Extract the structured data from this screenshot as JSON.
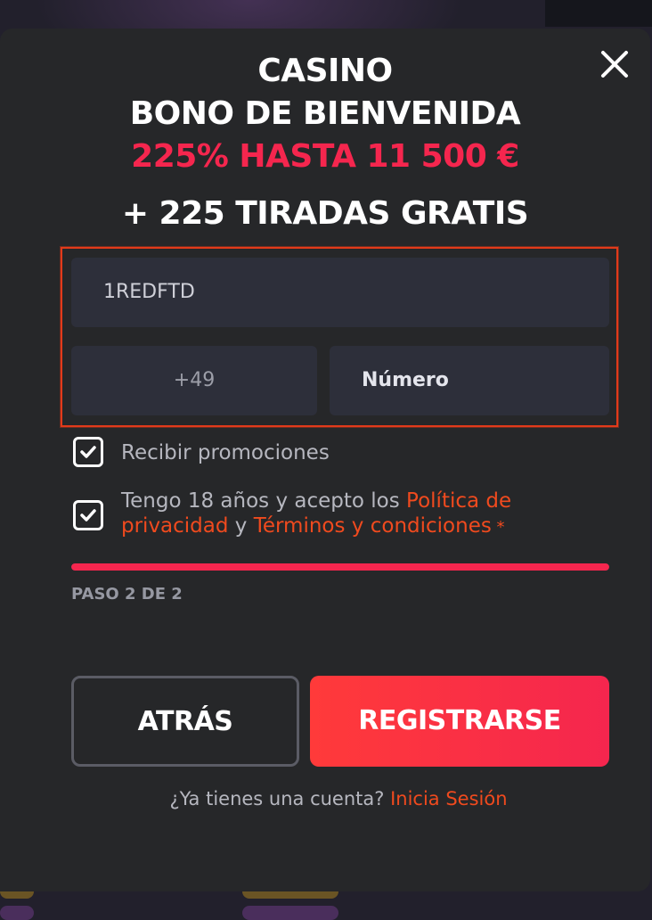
{
  "modal": {
    "title_line1": "CASINO",
    "title_line2": "BONO DE BIENVENIDA",
    "title_highlight": "225% HASTA 11 500 €",
    "title_line4": "+ 225 TIRADAS GRATIS"
  },
  "form": {
    "promo_code_value": "1REDFTD",
    "phone_prefix_value": "+49",
    "phone_number_placeholder": "Número"
  },
  "checkboxes": {
    "promotions_label": "Recibir promociones",
    "promotions_checked": true,
    "terms_prefix": "Tengo 18 años y acepto los ",
    "privacy_link": "Política de privacidad",
    "terms_joiner": " y ",
    "terms_link": "Términos y condiciones",
    "terms_required": " *",
    "terms_checked": true
  },
  "progress": {
    "step_label": "PASO 2 DE 2",
    "fraction": 1.0
  },
  "buttons": {
    "back_label": "ATRÁS",
    "register_label": "REGISTRARSE"
  },
  "login": {
    "prompt": "¿Ya tienes una cuenta? ",
    "link": "Inicia Sesión"
  },
  "colors": {
    "accent_red": "#f5264e",
    "link_orange": "#f04a1e",
    "modal_bg": "#262729",
    "field_bg": "#2d2f3a",
    "focus_border": "#e23a1a"
  },
  "icons": {
    "close": "close-icon",
    "check": "checkmark-icon"
  }
}
